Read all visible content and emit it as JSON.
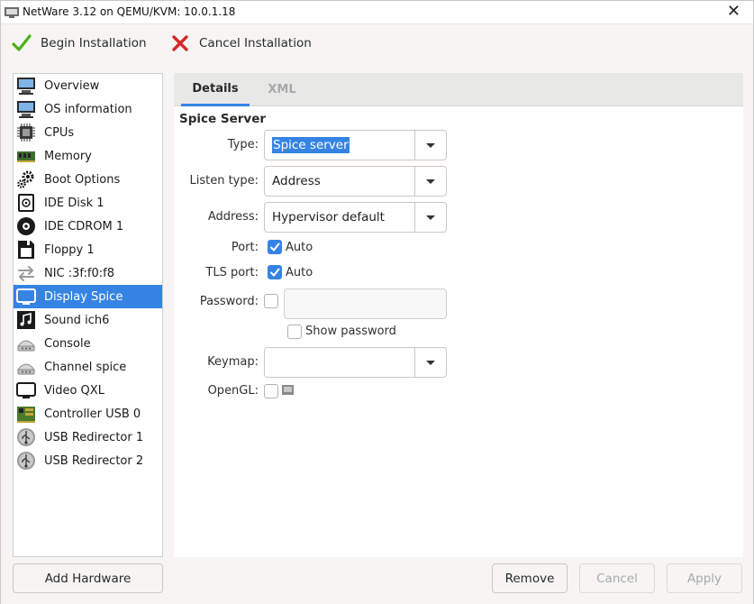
{
  "window": {
    "title": "NetWare 3.12 on QEMU/KVM: 10.0.1.18",
    "close_glyph": "✕"
  },
  "toolbar": {
    "begin_label": "Begin Installation",
    "cancel_label": "Cancel Installation"
  },
  "sidebar": {
    "items": [
      {
        "label": "Overview",
        "icon": "monitor-icon"
      },
      {
        "label": "OS information",
        "icon": "monitor-icon"
      },
      {
        "label": "CPUs",
        "icon": "cpu-icon"
      },
      {
        "label": "Memory",
        "icon": "memory-icon"
      },
      {
        "label": "Boot Options",
        "icon": "gears-icon"
      },
      {
        "label": "IDE Disk 1",
        "icon": "disk-icon"
      },
      {
        "label": "IDE CDROM 1",
        "icon": "cdrom-icon"
      },
      {
        "label": "Floppy 1",
        "icon": "floppy-icon"
      },
      {
        "label": "NIC :3f:f0:f8",
        "icon": "network-icon"
      },
      {
        "label": "Display Spice",
        "icon": "display-icon"
      },
      {
        "label": "Sound ich6",
        "icon": "sound-icon"
      },
      {
        "label": "Console",
        "icon": "serial-icon"
      },
      {
        "label": "Channel spice",
        "icon": "serial-icon"
      },
      {
        "label": "Video QXL",
        "icon": "display-icon"
      },
      {
        "label": "Controller USB 0",
        "icon": "controller-icon"
      },
      {
        "label": "USB Redirector 1",
        "icon": "usb-icon"
      },
      {
        "label": "USB Redirector 2",
        "icon": "usb-icon"
      }
    ],
    "selected": "Display Spice"
  },
  "tabs": {
    "details": "Details",
    "xml": "XML",
    "active": "Details"
  },
  "details": {
    "section_title": "Spice Server",
    "type_label": "Type:",
    "type_value": "Spice server",
    "listen_label": "Listen type:",
    "listen_value": "Address",
    "address_label": "Address:",
    "address_value": "Hypervisor default",
    "port_label": "Port:",
    "port_auto_label": "Auto",
    "port_auto_checked": true,
    "tls_label": "TLS port:",
    "tls_auto_label": "Auto",
    "tls_auto_checked": true,
    "password_label": "Password:",
    "password_checked": false,
    "password_value": "",
    "show_password_label": "Show password",
    "show_password_checked": false,
    "keymap_label": "Keymap:",
    "keymap_value": "",
    "opengl_label": "OpenGL:",
    "opengl_checked": false
  },
  "buttons": {
    "add_hardware": "Add Hardware",
    "remove": "Remove",
    "cancel": "Cancel",
    "apply": "Apply"
  },
  "colors": {
    "accent": "#3584e4",
    "check_green": "#4caf1a",
    "cancel_red": "#d62828"
  }
}
